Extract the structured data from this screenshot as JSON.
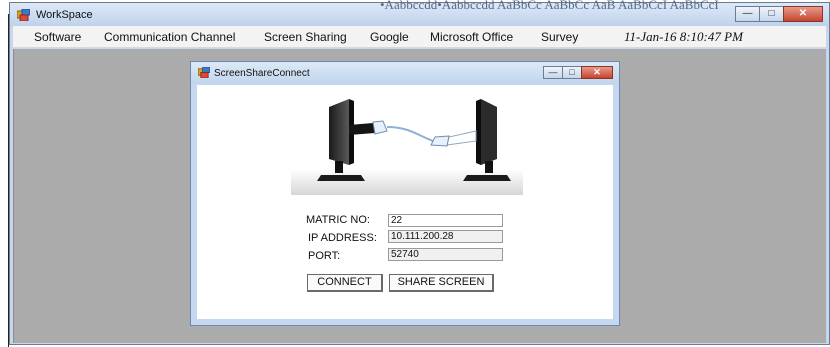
{
  "main_window": {
    "title": "WorkSpace",
    "behind_text": "•Aabbccdd•Aabbccdd  AaBbCc  AaBbCc  AaB  AaBbCcI  AaBbCcI"
  },
  "menu": {
    "items": [
      "Software",
      "Communication Channel",
      "Screen Sharing",
      "Google",
      "Microsoft Office",
      "Survey"
    ],
    "datetime": "11-Jan-16 8:10:47 PM"
  },
  "child_window": {
    "title": "ScreenShareConnect"
  },
  "form": {
    "matric_label": "MATRIC NO:",
    "matric_value": "22",
    "ip_label": "IP ADDRESS:",
    "ip_value": "10.111.200.28",
    "port_label": "PORT:",
    "port_value": "52740",
    "connect_label": "CONNECT",
    "share_label": "SHARE SCREEN"
  },
  "icons": {
    "app": "app-window-icon",
    "minimize": "minimize-icon",
    "maximize": "maximize-icon",
    "close": "close-icon"
  },
  "colors": {
    "titlebar": "#c7d7ec",
    "mdi_background": "#ababab",
    "close_button": "#c54530"
  }
}
